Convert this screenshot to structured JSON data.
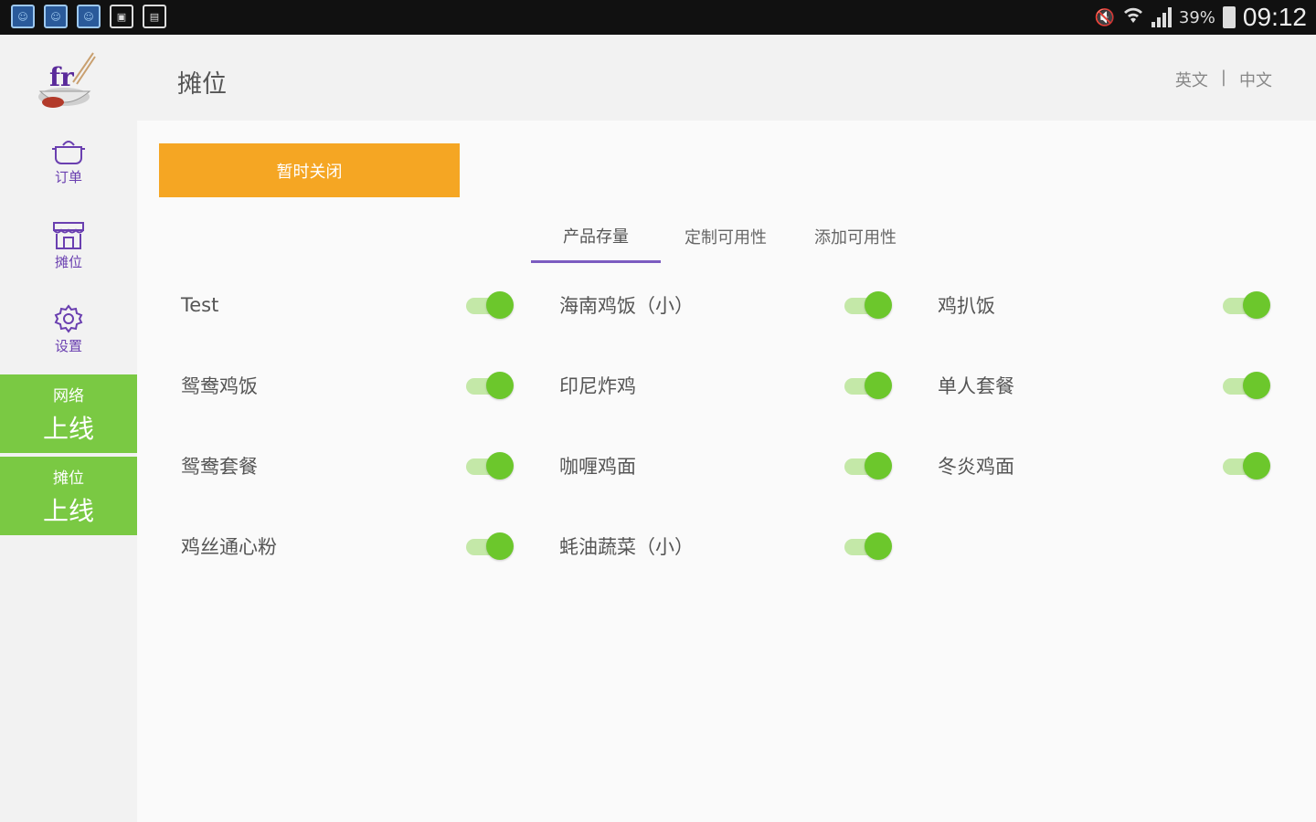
{
  "statusbar": {
    "icons_left": [
      "notification-icon",
      "notification-icon",
      "notification-icon",
      "image-icon",
      "file-icon"
    ],
    "battery": "39%",
    "time": "09:12"
  },
  "sidebar": {
    "nav": [
      {
        "label": "订单",
        "icon": "pot-icon"
      },
      {
        "label": "摊位",
        "icon": "stall-icon"
      },
      {
        "label": "设置",
        "icon": "gear-icon"
      }
    ],
    "network": {
      "title": "网络",
      "status": "上线"
    },
    "stall": {
      "title": "摊位",
      "status": "上线"
    }
  },
  "header": {
    "title": "摊位",
    "lang_en": "英文",
    "lang_sep": "|",
    "lang_zh": "中文"
  },
  "main": {
    "close_button": "暂时关闭",
    "tabs": [
      "产品存量",
      "定制可用性",
      "添加可用性"
    ],
    "items": [
      {
        "name": "Test",
        "on": true
      },
      {
        "name": "海南鸡饭（小）",
        "on": true
      },
      {
        "name": "鸡扒饭",
        "on": true
      },
      {
        "name": "鸳鸯鸡饭",
        "on": true
      },
      {
        "name": "印尼炸鸡",
        "on": true
      },
      {
        "name": "单人套餐",
        "on": true
      },
      {
        "name": "鸳鸯套餐",
        "on": true
      },
      {
        "name": "咖喱鸡面",
        "on": true
      },
      {
        "name": "冬炎鸡面",
        "on": true
      },
      {
        "name": "鸡丝通心粉",
        "on": true
      },
      {
        "name": "蚝油蔬菜（小）",
        "on": true
      }
    ]
  },
  "colors": {
    "accent_green": "#7ac943",
    "toggle_green": "#6cc72c",
    "button_orange": "#f5a623",
    "tab_underline": "#7b5cc0",
    "nav_purple": "#6a3fb0"
  }
}
